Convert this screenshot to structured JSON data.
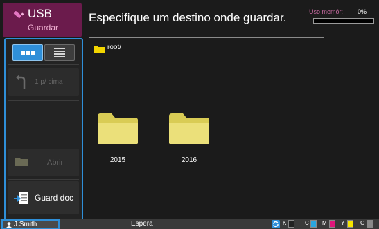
{
  "header": {
    "app_title": "USB",
    "app_subtitle": "Guardar",
    "instruction": "Especifique um destino onde guardar.",
    "memory_label": "Uso memór:",
    "memory_percent": "0%"
  },
  "toolbar": {
    "up_label": "1 p/ cima",
    "open_label": "Abrir",
    "save_label": "Guard doc",
    "active_view": "grid"
  },
  "path": {
    "current": "root/"
  },
  "folders": [
    {
      "name": "2015"
    },
    {
      "name": "2016"
    }
  ],
  "status": {
    "user": "J.Smith",
    "state": "Espera",
    "inks": [
      {
        "letter": "K",
        "color": "#111111"
      },
      {
        "letter": "C",
        "color": "#2aa7e0"
      },
      {
        "letter": "M",
        "color": "#e0157a"
      },
      {
        "letter": "Y",
        "color": "#f5e400"
      },
      {
        "letter": "G",
        "color": "#8a8a8a"
      }
    ]
  },
  "colors": {
    "accent": "#2f8fd8",
    "usb_tab": "#6b1b4c",
    "folder": "#e8dc6a"
  },
  "icons": {
    "usb": "usb-pen-icon",
    "grid": "grid-view-icon",
    "list": "list-view-icon",
    "up": "up-arrow-icon",
    "open": "open-folder-icon",
    "save": "save-document-icon",
    "folder": "folder-icon",
    "user": "user-icon",
    "sync": "sync-icon"
  }
}
